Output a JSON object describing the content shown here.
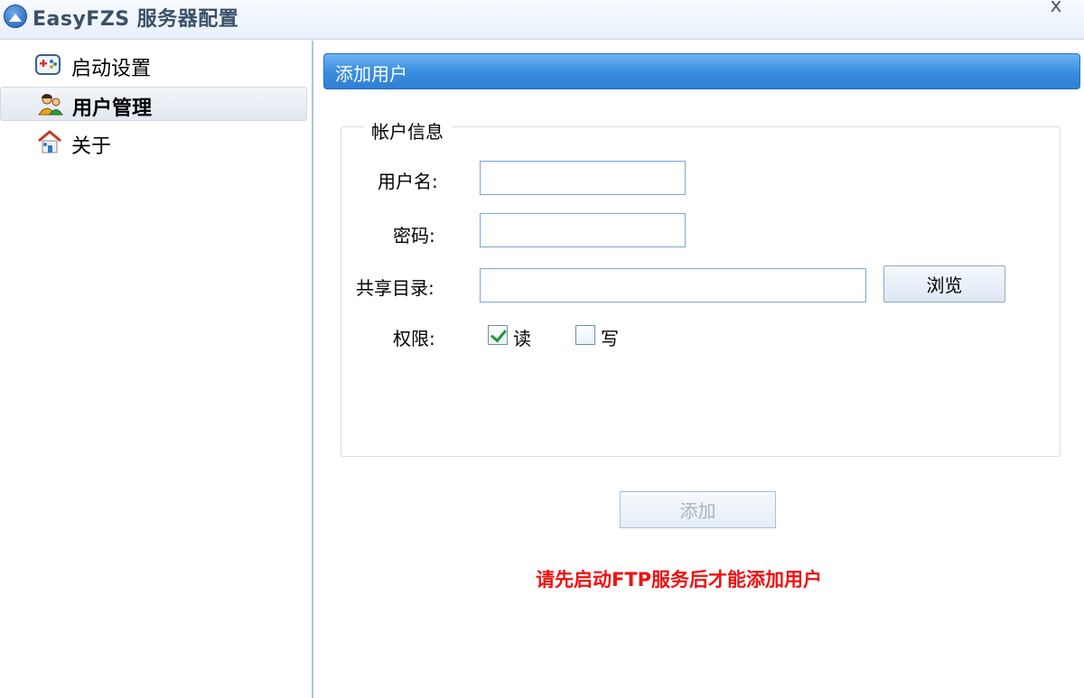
{
  "window": {
    "title": "EasyFZS 服务器配置",
    "close_label": "x"
  },
  "sidebar": {
    "items": [
      {
        "label": "启动设置",
        "icon": "gamepad-icon",
        "selected": false
      },
      {
        "label": "用户管理",
        "icon": "users-icon",
        "selected": true
      },
      {
        "label": "关于",
        "icon": "home-icon",
        "selected": false
      }
    ]
  },
  "main": {
    "header": "添加用户",
    "group_title": "帐户信息",
    "fields": {
      "username_label": "用户名:",
      "username_value": "",
      "password_label": "密码:",
      "password_value": "",
      "share_dir_label": "共享目录:",
      "share_dir_value": ""
    },
    "browse_label": "浏览",
    "permissions": {
      "label": "权限:",
      "read_label": "读",
      "read_checked": true,
      "write_label": "写",
      "write_checked": false
    },
    "add_button": "添加",
    "warning": "请先启动FTP服务后才能添加用户"
  },
  "colors": {
    "header_blue": "#3b8fe0",
    "warning_red": "#f01010",
    "check_green": "#1c9a2e"
  }
}
